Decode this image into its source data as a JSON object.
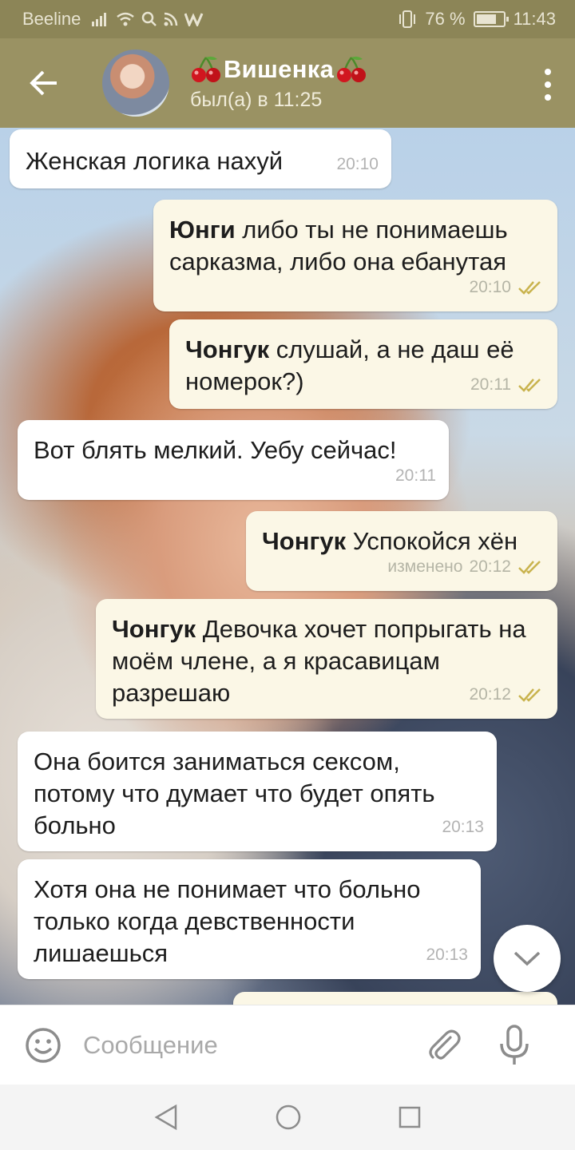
{
  "status_bar": {
    "carrier": "Beeline",
    "battery_percent": "76 %",
    "battery_level": 0.76,
    "time": "11:43"
  },
  "header": {
    "title": "Вишенка",
    "status": "был(а) в 11:25"
  },
  "messages": [
    {
      "direction": "in",
      "sender": "",
      "text": "Женская логика нахуй",
      "time": "20:10",
      "edited": ""
    },
    {
      "direction": "out",
      "sender": "Юнги",
      "text": " либо ты не понимаешь сарказма, либо она ебанутая",
      "time": "20:10",
      "edited": ""
    },
    {
      "direction": "out",
      "sender": "Чонгук",
      "text": " слушай, а не даш её номерок?)",
      "time": "20:11",
      "edited": ""
    },
    {
      "direction": "in",
      "sender": "",
      "text": "Вот блять мелкий. Уебу сейчас!",
      "time": "20:11",
      "edited": ""
    },
    {
      "direction": "out",
      "sender": "Чонгук",
      "text": " Успокойся хён",
      "time": "20:12",
      "edited": "изменено"
    },
    {
      "direction": "out",
      "sender": "Чонгук",
      "text": " Девочка хочет попрыгать на моём члене, а я красавицам разрешаю",
      "time": "20:12",
      "edited": ""
    },
    {
      "direction": "in",
      "sender": "",
      "text": "Она боится заниматься сексом, потому что думает что будет опять больно",
      "time": "20:13",
      "edited": ""
    },
    {
      "direction": "in",
      "sender": "",
      "text": "Хотя она не понимает что больно только когда девственности лишаешься",
      "time": "20:13",
      "edited": ""
    }
  ],
  "input": {
    "placeholder": "Сообщение"
  },
  "colors": {
    "header": "#9a9263",
    "status_bar": "#8c8557",
    "outgoing_bubble": "#fbf7e6",
    "incoming_bubble": "#ffffff",
    "read_checks": "#c9b34e"
  },
  "icons": {
    "back": "arrow-left-icon",
    "menu": "more-vertical-icon",
    "scroll_down": "chevron-down-icon",
    "emoji": "smile-icon",
    "attach": "paperclip-icon",
    "mic": "microphone-icon",
    "nav_back": "triangle-back-icon",
    "nav_home": "circle-home-icon",
    "nav_recents": "square-recents-icon"
  }
}
